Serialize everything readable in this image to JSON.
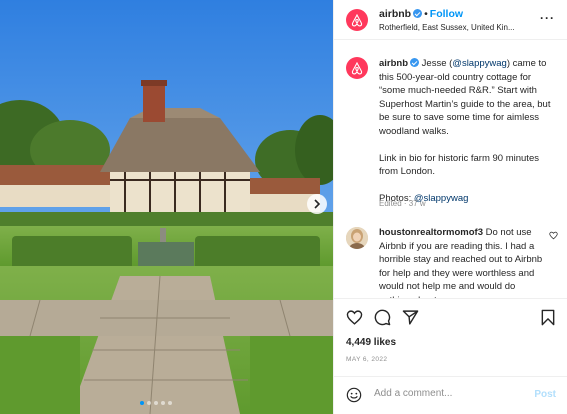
{
  "header": {
    "username": "airbnb",
    "follow_label": "Follow",
    "location": "Rotherfield, East Sussex, United Kin..."
  },
  "caption": {
    "username": "airbnb",
    "text_1_pre": "Jesse (",
    "mention_1": "@slappywag",
    "text_1_post": ") came to this 500-year-old country cottage for “some much-needed R&R.” Start with Superhost Martin’s guide to the area, but be sure to save some time for aimless woodland walks.",
    "text_2": "Link in bio for historic farm 90 minutes from London.",
    "text_3_pre": "Photos: ",
    "mention_2": "@slappywag",
    "edited": "Edited · 37 w"
  },
  "comment2": {
    "username": "houstonrealtormomof3",
    "text": "Do not use Airbnb if you are reading this. I had a horrible stay and reached out to Airbnb for help and they were worthless and would not help me and would do nothing about"
  },
  "likes": "4,449 likes",
  "date": "MAY 6, 2022",
  "comment_box": {
    "placeholder": "Add a comment...",
    "post_label": "Post"
  },
  "colors": {
    "brand": "#ff385c",
    "link": "#0095f6",
    "mention": "#00376b"
  },
  "carousel": {
    "slides": 5,
    "active_index": 0
  },
  "icons": [
    "airbnb-logo-icon",
    "verified-badge-icon",
    "more-options-icon",
    "heart-icon",
    "comment-icon",
    "share-icon",
    "save-icon",
    "emoji-icon",
    "next-slide-icon"
  ]
}
